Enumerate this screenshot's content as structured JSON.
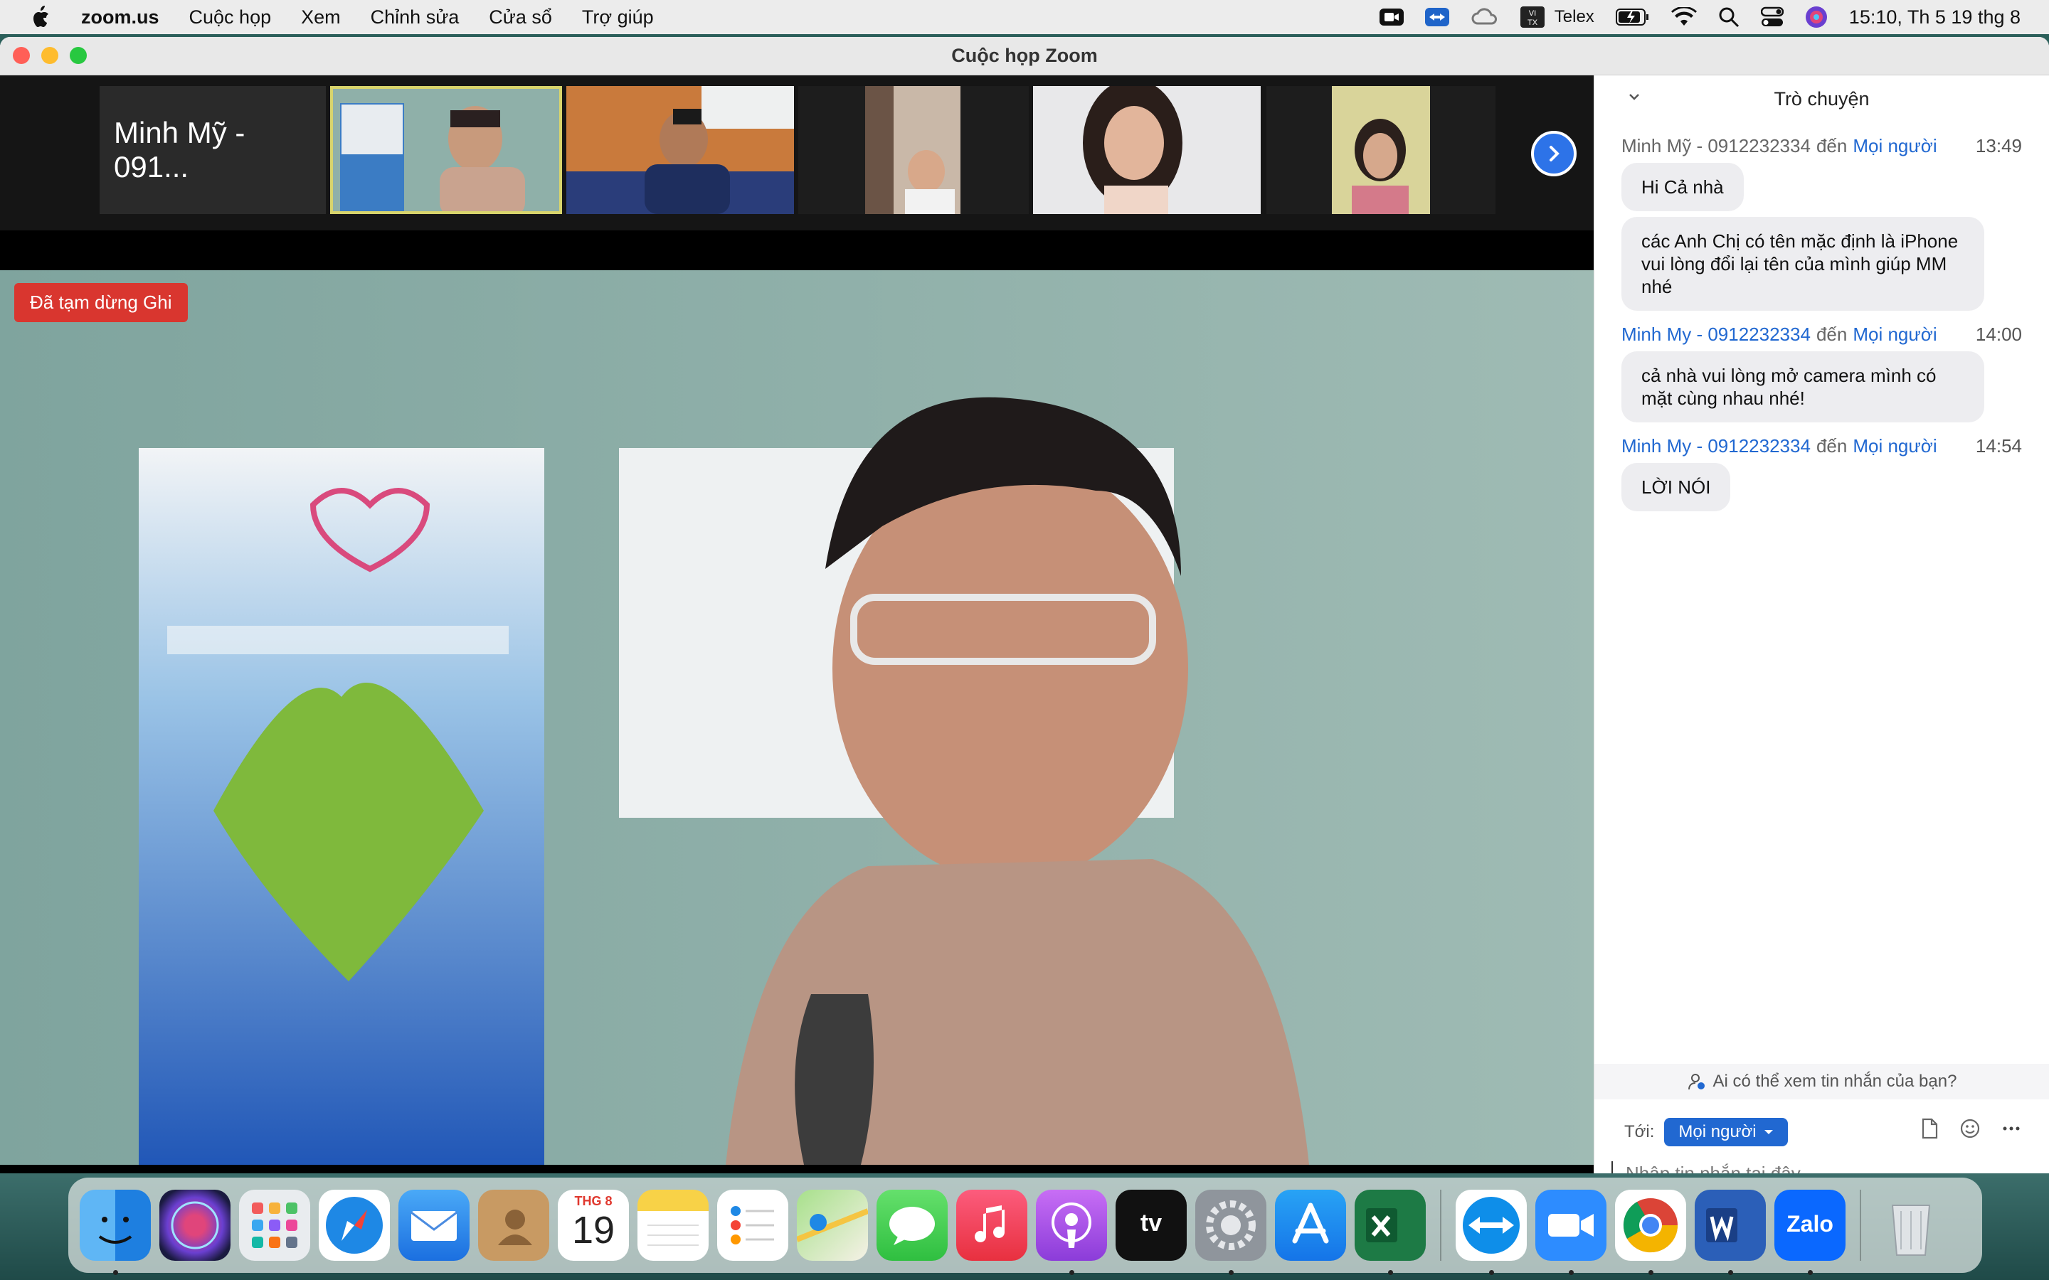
{
  "menubar": {
    "app": "zoom.us",
    "items": [
      "Cuộc họp",
      "Xem",
      "Chỉnh sửa",
      "Cửa sổ",
      "Trợ giúp"
    ],
    "input_method": "Telex",
    "clock": "15:10, Th 5 19 thg 8"
  },
  "window": {
    "title": "Cuộc họp Zoom"
  },
  "video": {
    "first_tile_name": "Minh Mỹ - 091...",
    "recording_badge": "Đã tạm dừng Ghi"
  },
  "chat": {
    "title": "Trò chuyện",
    "messages": [
      {
        "sender": "Minh Mỹ - 0912232334",
        "to_word": "đến",
        "to": "Mọi người",
        "time": "13:49",
        "texts": [
          "Hi Cả nhà",
          "các Anh Chị có tên mặc định là iPhone  vui lòng đổi lại tên của mình giúp MM nhé"
        ]
      },
      {
        "sender": "Minh My - 0912232334",
        "to_word": "đến",
        "to": "Mọi người",
        "time": "14:00",
        "texts": [
          "cả nhà vui lòng mở camera mình có mặt cùng nhau nhé!"
        ]
      },
      {
        "sender": "Minh My - 0912232334",
        "to_word": "đến",
        "to": "Mọi người",
        "time": "14:54",
        "texts": [
          "LỜI NÓI"
        ]
      }
    ],
    "privacy_text": "Ai có thể xem tin nhắn của bạn?",
    "to_label": "Tới:",
    "recipient": "Mọi người",
    "input_placeholder": "Nhập tin nhắn tại đây..."
  },
  "dock": {
    "calendar_month": "THG 8",
    "calendar_day": "19",
    "apps": [
      "finder",
      "siri",
      "launchpad",
      "safari",
      "mail",
      "contacts",
      "calendar",
      "notes",
      "reminders",
      "maps",
      "messages",
      "music",
      "podcasts",
      "apple-tv",
      "system-preferences",
      "app-store",
      "excel",
      "teamviewer",
      "zoom",
      "chrome",
      "word",
      "zalo",
      "trash"
    ],
    "appletv_label": "tv",
    "zalo_label": "Zalo"
  }
}
